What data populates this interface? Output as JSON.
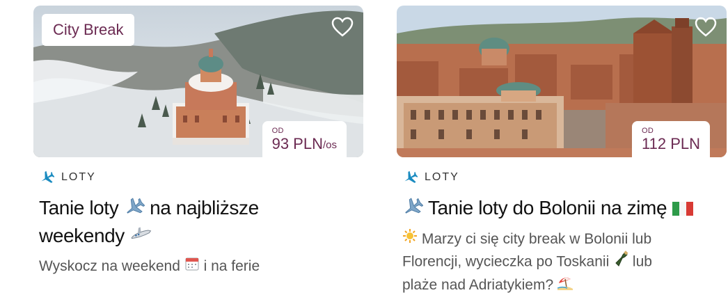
{
  "cards": [
    {
      "badge": "City Break",
      "price_prefix": "OD",
      "price_amount": "93 PLN",
      "price_unit": "/os",
      "category": "LOTY",
      "title_a": "Tanie loty",
      "title_b": "na najbliższe",
      "title_c": "weekendy",
      "desc_a": "Wyskocz na weekend",
      "desc_b": "i na ferie"
    },
    {
      "price_prefix": "OD",
      "price_amount": "112 PLN",
      "category": "LOTY",
      "title_a": "Tanie loty do Bolonii na zimę",
      "desc_a": "Marzy ci się city break w Bolonii lub",
      "desc_b": "Florencji, wycieczka po Toskanii",
      "desc_c": "lub",
      "desc_d": "plaże nad Adriatykiem?"
    }
  ],
  "colors": {
    "accent": "#6b2a52",
    "plane_icon": "#1a8bc0"
  },
  "icons": [
    "heart-icon",
    "airplane-icon",
    "airplane-emoji",
    "private-jet-emoji",
    "calendar-emoji",
    "sun-emoji",
    "italy-flag-emoji",
    "wine-bottle-emoji",
    "beach-umbrella-emoji"
  ]
}
